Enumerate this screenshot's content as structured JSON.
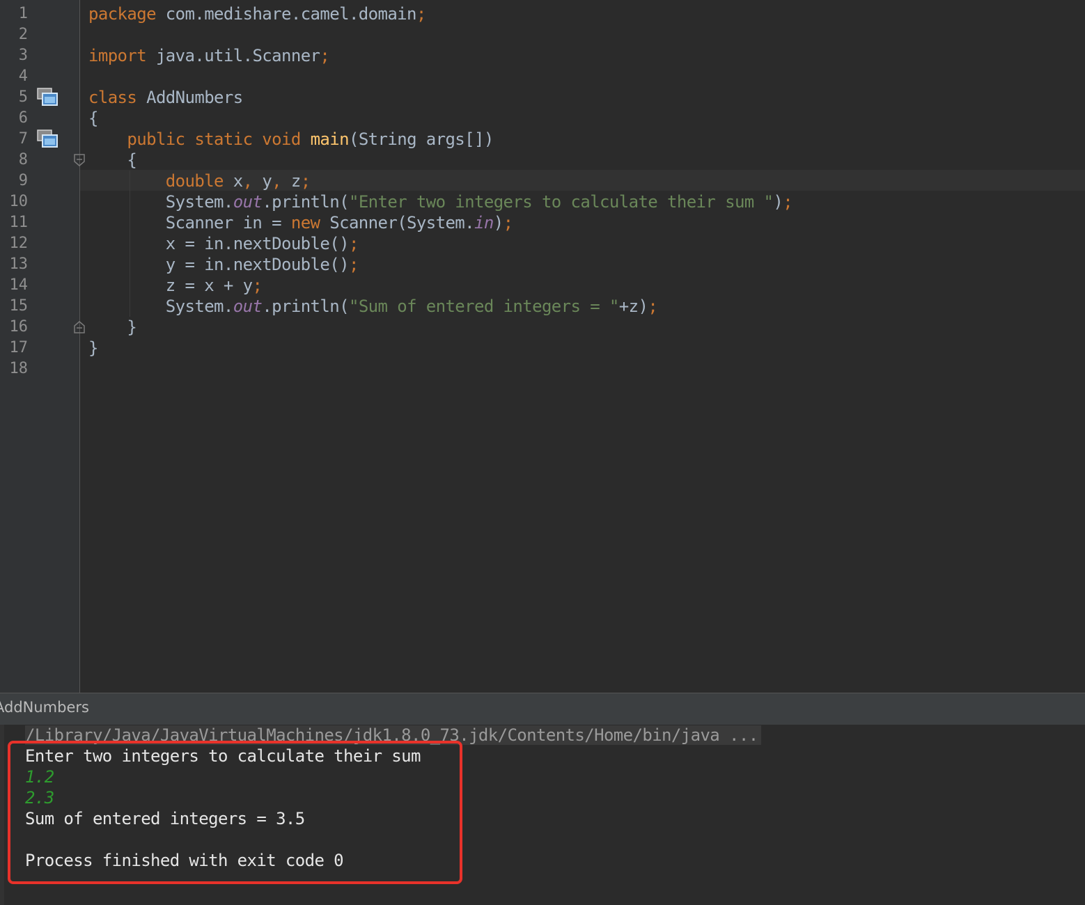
{
  "editor": {
    "line_numbers": [
      "1",
      "2",
      "3",
      "4",
      "5",
      "6",
      "7",
      "8",
      "9",
      "10",
      "11",
      "12",
      "13",
      "14",
      "15",
      "16",
      "17",
      "18"
    ],
    "code": {
      "l1_kw": "package",
      "l1_rest": " com.medishare.camel.domain",
      "l1_semi": ";",
      "l3_kw": "import",
      "l3_rest": " java.util.Scanner",
      "l3_semi": ";",
      "l5_kw": "class",
      "l5_rest": " AddNumbers",
      "l6": "{",
      "l7_indent": "    ",
      "l7_kw": "public static void",
      "l7_sp": " ",
      "l7_fn": "main",
      "l7_rest": "(String args[])",
      "l8": "    {",
      "l9_indent": "        ",
      "l9_kw": "double",
      "l9_x": " x",
      "l9_c1": ",",
      "l9_y": " y",
      "l9_c2": ",",
      "l9_z": " z",
      "l9_semi": ";",
      "l10_a": "        System.",
      "l10_out": "out",
      "l10_b": ".println(",
      "l10_str": "\"Enter two integers to calculate their sum \"",
      "l10_c": ")",
      "l10_semi": ";",
      "l11_a": "        Scanner in = ",
      "l11_kw": "new",
      "l11_b": " Scanner(System.",
      "l11_in": "in",
      "l11_c": ")",
      "l11_semi": ";",
      "l12_a": "        x = in.nextDouble()",
      "l12_semi": ";",
      "l13_a": "        y = in.nextDouble()",
      "l13_semi": ";",
      "l14_a": "        z = x + y",
      "l14_semi": ";",
      "l15_a": "        System.",
      "l15_out": "out",
      "l15_b": ".println(",
      "l15_str": "\"Sum of entered integers = \"",
      "l15_c": "+z)",
      "l15_semi": ";",
      "l16": "    }",
      "l17": "}"
    }
  },
  "run_panel": {
    "title": "AddNumbers",
    "command": "/Library/Java/JavaVirtualMachines/jdk1.8.0_73.jdk/Contents/Home/bin/java ...",
    "output": [
      "Enter two integers to calculate their sum",
      "1.2",
      "2.3",
      "Sum of entered integers = 3.5",
      "",
      "Process finished with exit code 0"
    ]
  },
  "colors": {
    "keyword": "#cc7832",
    "method": "#ffc66d",
    "string": "#6a8759",
    "field": "#9876aa",
    "text": "#a9b7c6",
    "user_input": "#2e9c2e",
    "highlight_border": "#e8322a"
  }
}
